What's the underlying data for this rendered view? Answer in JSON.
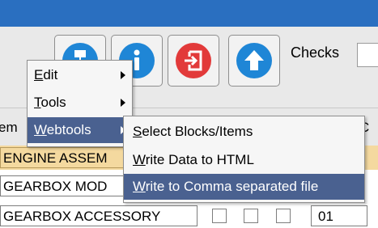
{
  "toolbar": {
    "checks_label": "Checks",
    "buttons": [
      {
        "name": "settings-button",
        "icon": "network-icon",
        "color": "#1f86d6"
      },
      {
        "name": "info-button",
        "icon": "info-icon",
        "color": "#1f86d6"
      },
      {
        "name": "exit-button",
        "icon": "exit-icon",
        "color": "#e23a3a"
      },
      {
        "name": "upload-button",
        "icon": "arrow-up-icon",
        "color": "#1f86d6"
      }
    ]
  },
  "grid": {
    "header": {
      "col_a": "em",
      "col_b": "C"
    },
    "rows": [
      {
        "description": "ENGINE ASSEM"
      },
      {
        "description": "GEARBOX MOD"
      },
      {
        "description": "GEARBOX ACCESSORY",
        "code": "01"
      }
    ]
  },
  "context_menu": {
    "items": [
      {
        "label_underlined": "E",
        "label_rest": "dit",
        "has_submenu": true
      },
      {
        "label_underlined": "T",
        "label_rest": "ools",
        "has_submenu": true
      },
      {
        "label_underlined": "W",
        "label_rest": "ebtools",
        "has_submenu": true,
        "highlighted": true
      }
    ]
  },
  "submenu": {
    "items": [
      {
        "label_underlined": "S",
        "label_rest": "elect Blocks/Items"
      },
      {
        "label_underlined": "W",
        "label_rest": "rite Data to HTML"
      },
      {
        "label_underlined": "W",
        "label_rest": "rite to Comma separated file",
        "highlighted": true
      }
    ]
  },
  "colors": {
    "titlebar": "#2a6fc0",
    "highlight": "#4a6190",
    "row_highlight": "#f4d99f"
  }
}
